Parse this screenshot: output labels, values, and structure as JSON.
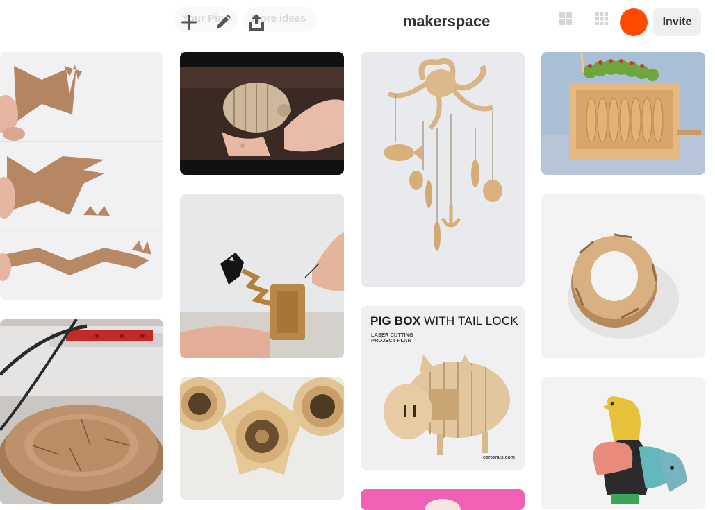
{
  "header": {
    "title": "makerspace",
    "ghost_tabs": [
      "Your Pins",
      "More ideas"
    ],
    "invite_label": "Invite",
    "avatar_color": "#ff4a02",
    "icons": [
      "plus-icon",
      "pencil-icon",
      "share-icon",
      "grid-icon",
      "compact-grid-icon"
    ]
  },
  "pins": [
    {
      "name": "crocodile-jaw-mechanism"
    },
    {
      "name": "piggy-bank-in-hands"
    },
    {
      "name": "octopus-mobile"
    },
    {
      "name": "caterpillar-automaton"
    },
    {
      "name": "shark-scissor-toy"
    },
    {
      "name": "layered-ring-mechanism"
    },
    {
      "name": "iris-box"
    },
    {
      "name": "gear-iris-ornaments"
    },
    {
      "name": "pig-box-plan"
    },
    {
      "name": "bird-toy"
    },
    {
      "name": "pink-pin"
    }
  ],
  "pig_box": {
    "title_bold": "PIG BOX",
    "title_rest": " WITH TAIL LOCK",
    "subtitle": "LASER CUTTING PROJECT PLAN",
    "credit": "cartonus.com"
  }
}
